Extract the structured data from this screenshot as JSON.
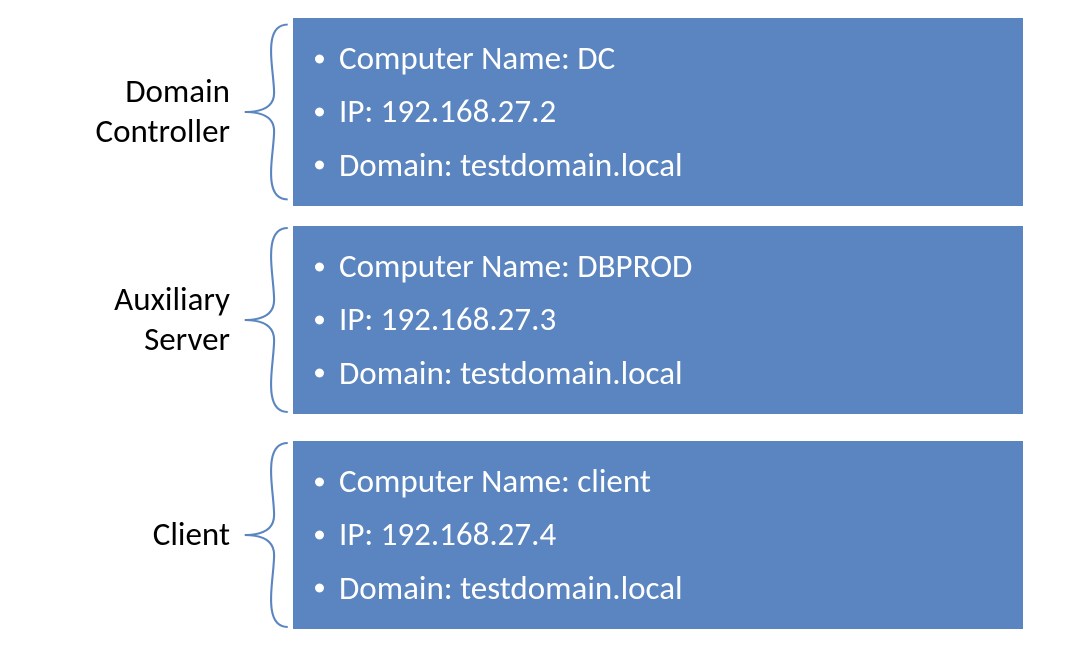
{
  "colors": {
    "box_bg": "#5b85c0",
    "box_text": "#ffffff",
    "label_text": "#000000",
    "brace": "#5b85c0"
  },
  "nodes": [
    {
      "label_line1": "Domain",
      "label_line2": "Controller",
      "items": [
        "Computer Name: DC",
        "IP: 192.168.27.2",
        "Domain: testdomain.local"
      ]
    },
    {
      "label_line1": "Auxiliary",
      "label_line2": "Server",
      "items": [
        "Computer Name: DBPROD",
        "IP: 192.168.27.3",
        "Domain: testdomain.local"
      ]
    },
    {
      "label_line1": "Client",
      "label_line2": "",
      "items": [
        "Computer Name: client",
        "IP: 192.168.27.4",
        "Domain: testdomain.local"
      ]
    }
  ]
}
